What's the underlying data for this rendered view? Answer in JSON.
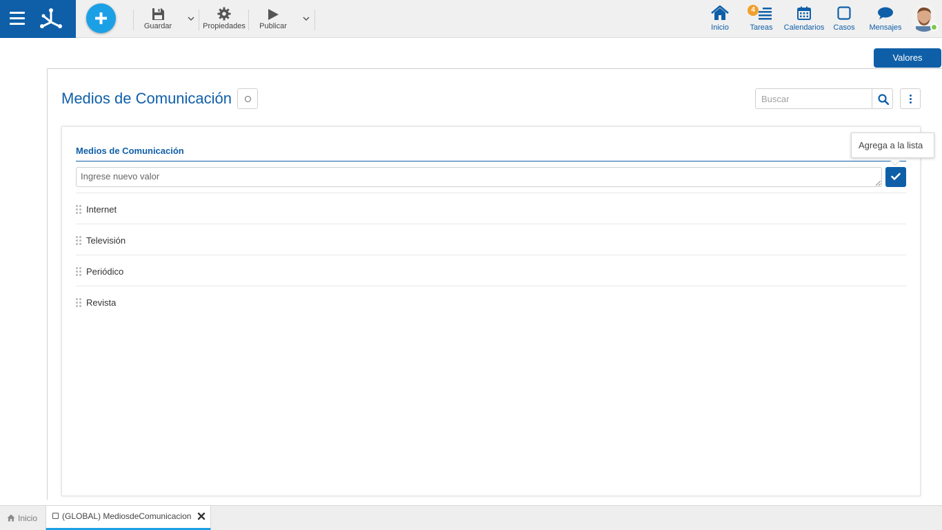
{
  "toolbar": {
    "save_label": "Guardar",
    "properties_label": "Propiedades",
    "publish_label": "Publicar"
  },
  "nav": {
    "home_label": "Inicio",
    "tasks_label": "Tareas",
    "tasks_badge": "4",
    "calendars_label": "Calendarios",
    "cases_label": "Casos",
    "messages_label": "Mensajes"
  },
  "header": {
    "values_button": "Valores"
  },
  "page": {
    "title": "Medios de Comunicación",
    "search_placeholder": "Buscar"
  },
  "section": {
    "title": "Medios de Comunicación",
    "new_value_placeholder": "Ingrese nuevo valor",
    "add_tooltip": "Agrega a la lista",
    "items": [
      {
        "label": "Internet"
      },
      {
        "label": "Televisión"
      },
      {
        "label": "Periódico"
      },
      {
        "label": "Revista"
      }
    ]
  },
  "tabs": {
    "home_label": "Inicio",
    "document_label": "(GLOBAL) MediosdeComunicacion"
  },
  "colors": {
    "primary": "#0f5fa8",
    "accent": "#1ba0e6",
    "badge": "#f0a030",
    "online": "#7cc84a"
  },
  "icons": {
    "menu": "hamburger-icon",
    "logo": "app-logo",
    "add": "plus-icon",
    "save": "floppy-icon",
    "properties": "gear-icon",
    "publish": "play-icon",
    "home": "house-icon",
    "tasks": "tasks-icon",
    "calendars": "calendar-icon",
    "cases": "square-icon",
    "messages": "chat-bubble-icon",
    "search": "search-icon",
    "more": "vertical-dots-icon",
    "confirm": "check-icon",
    "drag": "drag-handle-icon",
    "close": "close-icon"
  }
}
